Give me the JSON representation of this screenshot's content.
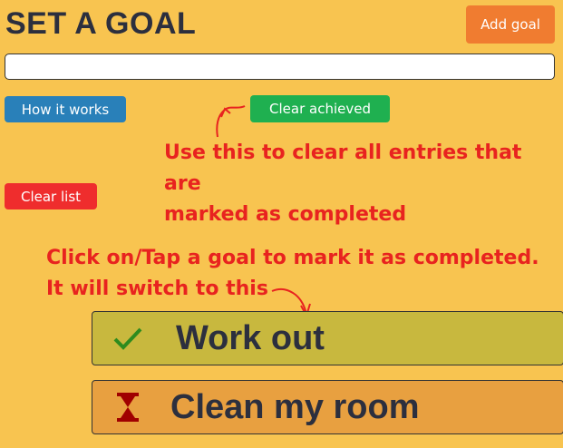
{
  "header": {
    "title": "SET A GOAL",
    "add_button_label": "Add goal"
  },
  "goal_input": {
    "value": "",
    "placeholder": ""
  },
  "controls": {
    "how_it_works_label": "How it works",
    "clear_achieved_label": "Clear achieved",
    "clear_list_label": "Clear list"
  },
  "annotations": {
    "clear_achieved_note_line1": "Use this to clear all entries that are",
    "clear_achieved_note_line2": "marked as completed",
    "tap_goal_note_line1": "Click on/Tap a goal to mark it as completed.",
    "tap_goal_note_line2": "It will switch to this"
  },
  "goals": [
    {
      "text": "Work out",
      "status": "completed",
      "icon": "checkmark-icon"
    },
    {
      "text": "Clean my room",
      "status": "pending",
      "icon": "hourglass-icon"
    }
  ],
  "colors": {
    "background": "#f8c450",
    "add_button": "#f07c30",
    "how_button": "#2980b9",
    "clear_achieved_button": "#1fb050",
    "clear_list_button": "#ef2d2d",
    "annotation_text": "#e8231f",
    "completed_goal": "#c8b83e",
    "pending_goal": "#e8a040"
  }
}
